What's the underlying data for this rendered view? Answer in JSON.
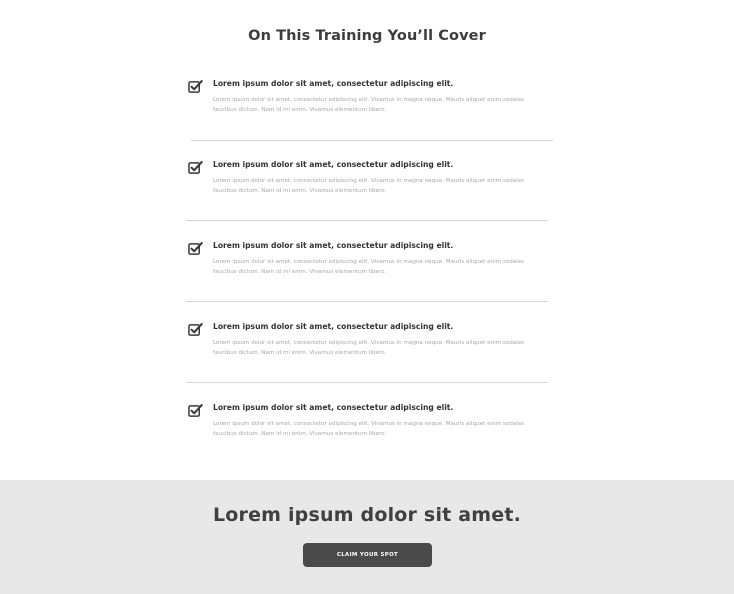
{
  "section": {
    "title": "On This Training You’ll Cover"
  },
  "items": [
    {
      "icon": "checkbox-checked-icon",
      "heading": "Lorem ipsum dolor sit amet, consectetur adipiscing elit.",
      "body": "Lorem ipsum dolor sit amet, consectetur adipiscing elit. Vivamus in magna neque. Mauris aliquet enim sodales faucibus dictum. Nam id mi enim. Vivamus elementum libero."
    },
    {
      "icon": "checkbox-checked-icon",
      "heading": "Lorem ipsum dolor sit amet, consectetur adipiscing elit.",
      "body": "Lorem ipsum dolor sit amet, consectetur adipiscing elit. Vivamus in magna neque. Mauris aliquet enim sodales faucibus dictum. Nam id mi enim. Vivamus elementum libero."
    },
    {
      "icon": "checkbox-checked-icon",
      "heading": "Lorem ipsum dolor sit amet, consectetur adipiscing elit.",
      "body": "Lorem ipsum dolor sit amet, consectetur adipiscing elit. Vivamus in magna neque. Mauris aliquet enim sodales faucibus dictum. Nam id mi enim. Vivamus elementum libero."
    },
    {
      "icon": "checkbox-checked-icon",
      "heading": "Lorem ipsum dolor sit amet, consectetur adipiscing elit.",
      "body": "Lorem ipsum dolor sit amet, consectetur adipiscing elit. Vivamus in magna neque. Mauris aliquet enim sodales faucibus dictum. Nam id mi enim. Vivamus elementum libero."
    },
    {
      "icon": "checkbox-checked-icon",
      "heading": "Lorem ipsum dolor sit amet, consectetur adipiscing elit.",
      "body": "Lorem ipsum dolor sit amet, consectetur adipiscing elit. Vivamus in magna neque. Mauris aliquet enim sodales faucibus dictum. Nam id mi enim. Vivamus elementum libero."
    }
  ],
  "cta": {
    "heading": "Lorem ipsum dolor sit amet.",
    "button_label": "CLAIM YOUR SPOT"
  },
  "colors": {
    "text_dark": "#3c3c3c",
    "text_muted": "#a8a8a8",
    "divider": "#d4d4d4",
    "cta_band": "#e8e8e8",
    "button_bg": "#4a4a4a",
    "button_text": "#ffffff"
  }
}
